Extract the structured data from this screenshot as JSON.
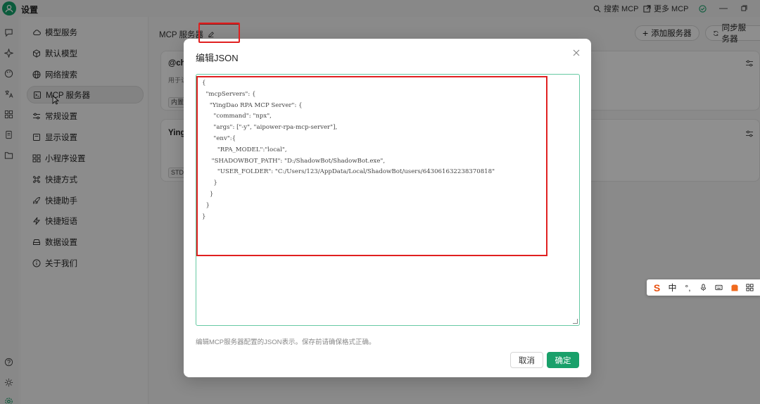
{
  "app": {
    "window_title": "设置",
    "search_mcp": "搜索 MCP",
    "more_mcp": "更多 MCP",
    "window_controls": [
      "minimize",
      "restore"
    ]
  },
  "nav": {
    "items": [
      {
        "label": "模型服务",
        "icon": "cloud-icon"
      },
      {
        "label": "默认模型",
        "icon": "cube-icon"
      },
      {
        "label": "网络搜索",
        "icon": "globe-icon"
      },
      {
        "label": "MCP 服务器",
        "icon": "server-icon",
        "active": true
      },
      {
        "label": "常规设置",
        "icon": "sliders-icon"
      },
      {
        "label": "显示设置",
        "icon": "monitor-icon"
      },
      {
        "label": "小程序设置",
        "icon": "grid-icon"
      },
      {
        "label": "快捷方式",
        "icon": "command-icon"
      },
      {
        "label": "快捷助手",
        "icon": "rocket-icon"
      },
      {
        "label": "快捷短语",
        "icon": "zap-icon"
      },
      {
        "label": "数据设置",
        "icon": "database-icon"
      },
      {
        "label": "关于我们",
        "icon": "info-icon"
      }
    ]
  },
  "main": {
    "title": "MCP 服务器",
    "add_server": "添加服务器",
    "sync_servers": "同步服务器",
    "cards": [
      {
        "title": "@ch",
        "desc": "用于访",
        "tag": "内置"
      },
      {
        "title": "Ying",
        "desc": "",
        "tag": "STD"
      }
    ]
  },
  "modal": {
    "title": "编辑JSON",
    "json_text": "{\n  \"mcpServers\": {\n    \"YingDao RPA MCP Server\": {\n      \"command\": \"npx\",\n      \"args\": [\"-y\", \"aipower-rpa-mcp-server\"],\n      \"env\":{\n        \"RPA_MODEL\":\"local\",\n     \"SHADOWBOT_PATH\": \"D:/ShadowBot/ShadowBot.exe\",\n        \"USER_FOLDER\": \"C:/Users/123/AppData/Local/ShadowBot/users/643061632238370818\"\n      }\n    }\n  }\n}",
    "hint": "编辑MCP服务器配置的JSON表示。保存前请确保格式正确。",
    "cancel": "取消",
    "confirm": "确定"
  },
  "ime": {
    "lang": "中",
    "punct": "°,"
  },
  "colors": {
    "accent": "#19a06a",
    "highlight": "#e02020",
    "editor_border": "#66c9a3"
  }
}
